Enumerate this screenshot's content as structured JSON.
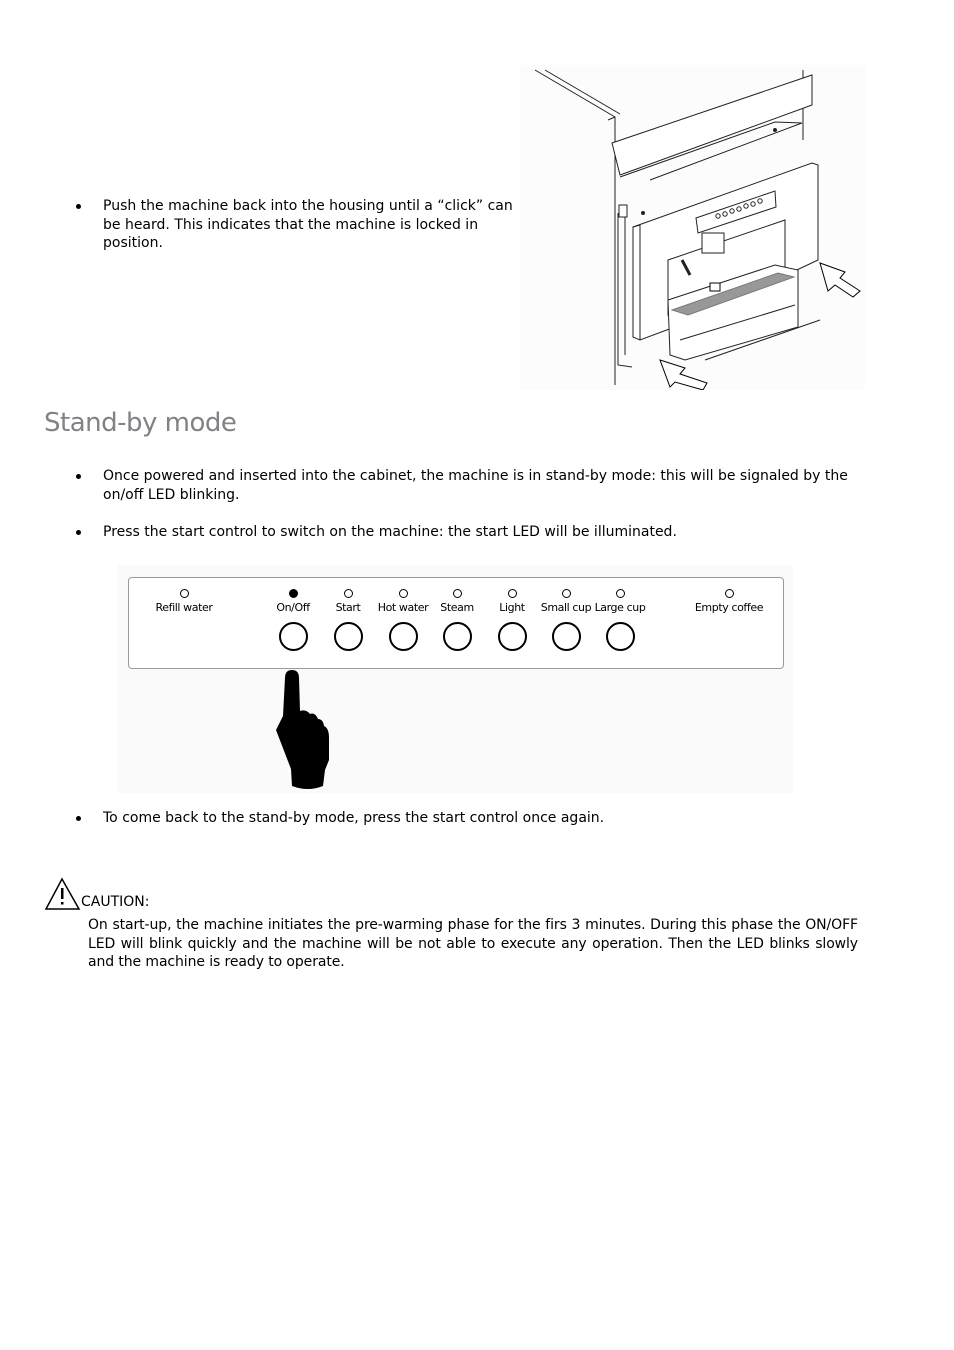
{
  "install_step": {
    "bullet": "Push the machine back into the housing until a “click” can be heard. This indicates that the machine is locked in position."
  },
  "section": {
    "title": "Stand-by mode",
    "bullets": [
      "Once powered and inserted into the cabinet, the machine is in stand-by mode: this will be signaled by the on/off LED blinking.",
      "Press the start control to switch on the machine: the start LED will be illuminated."
    ],
    "after_figure_bullet": "To come back to the stand-by mode, press the start control once again."
  },
  "control_panel": {
    "controls": [
      {
        "label": "Refill water",
        "led_on": false,
        "has_button": false
      },
      {
        "label": "On/Off",
        "led_on": true,
        "has_button": true
      },
      {
        "label": "Start",
        "led_on": false,
        "has_button": true
      },
      {
        "label": "Hot water",
        "led_on": false,
        "has_button": true
      },
      {
        "label": "Steam",
        "led_on": false,
        "has_button": true
      },
      {
        "label": "Light",
        "led_on": false,
        "has_button": true
      },
      {
        "label": "Small cup",
        "led_on": false,
        "has_button": true
      },
      {
        "label": "Large cup",
        "led_on": false,
        "has_button": true
      },
      {
        "label": "Empty coffee",
        "led_on": false,
        "has_button": false
      }
    ],
    "pressed_control": "On/Off"
  },
  "caution": {
    "icon": "warning-triangle-icon",
    "label": "CAUTION:",
    "text": "On start-up, the machine initiates the pre-warming phase for the firs 3 minutes. During this phase the ON/OFF LED will blink quickly and the machine will be not able to execute any operation. Then the LED blinks slowly and the machine is ready to operate."
  }
}
